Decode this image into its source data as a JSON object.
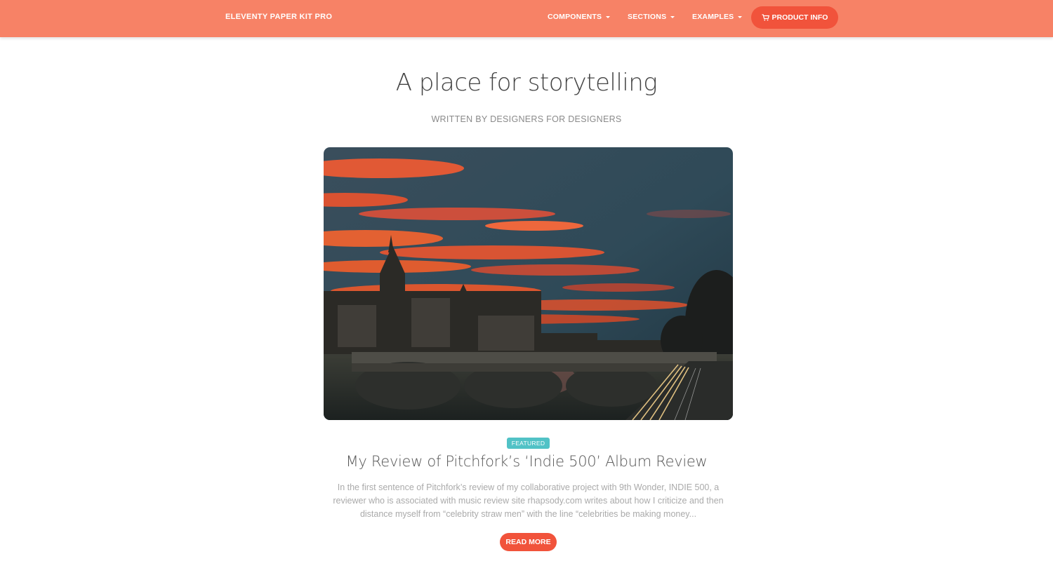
{
  "navbar": {
    "brand": "ELEVENTY PAPER KIT PRO",
    "items": [
      {
        "label": "COMPONENTS"
      },
      {
        "label": "SECTIONS"
      },
      {
        "label": "EXAMPLES"
      }
    ],
    "cta_label": "PRODUCT INFO",
    "cta_icon": "cart-icon"
  },
  "header": {
    "title": "A place for storytelling",
    "subtitle": "WRITTEN BY DESIGNERS FOR DESIGNERS"
  },
  "article": {
    "badge": "FEATURED",
    "title": "My Review of Pitchfork’s ‘Indie 500’ Album Review",
    "excerpt": "In the first sentence of Pitchfork’s review of my collaborative project with 9th Wonder, INDIE 500, a reviewer who is associated with music review site rhapsody.com writes about how I criticize and then distance myself from “celebrity straw men” with the line “celebrities be making money...",
    "read_more_label": "READ MORE"
  },
  "colors": {
    "navbar_bg": "#f78266",
    "accent": "#f1533b",
    "badge": "#51c2c6"
  }
}
